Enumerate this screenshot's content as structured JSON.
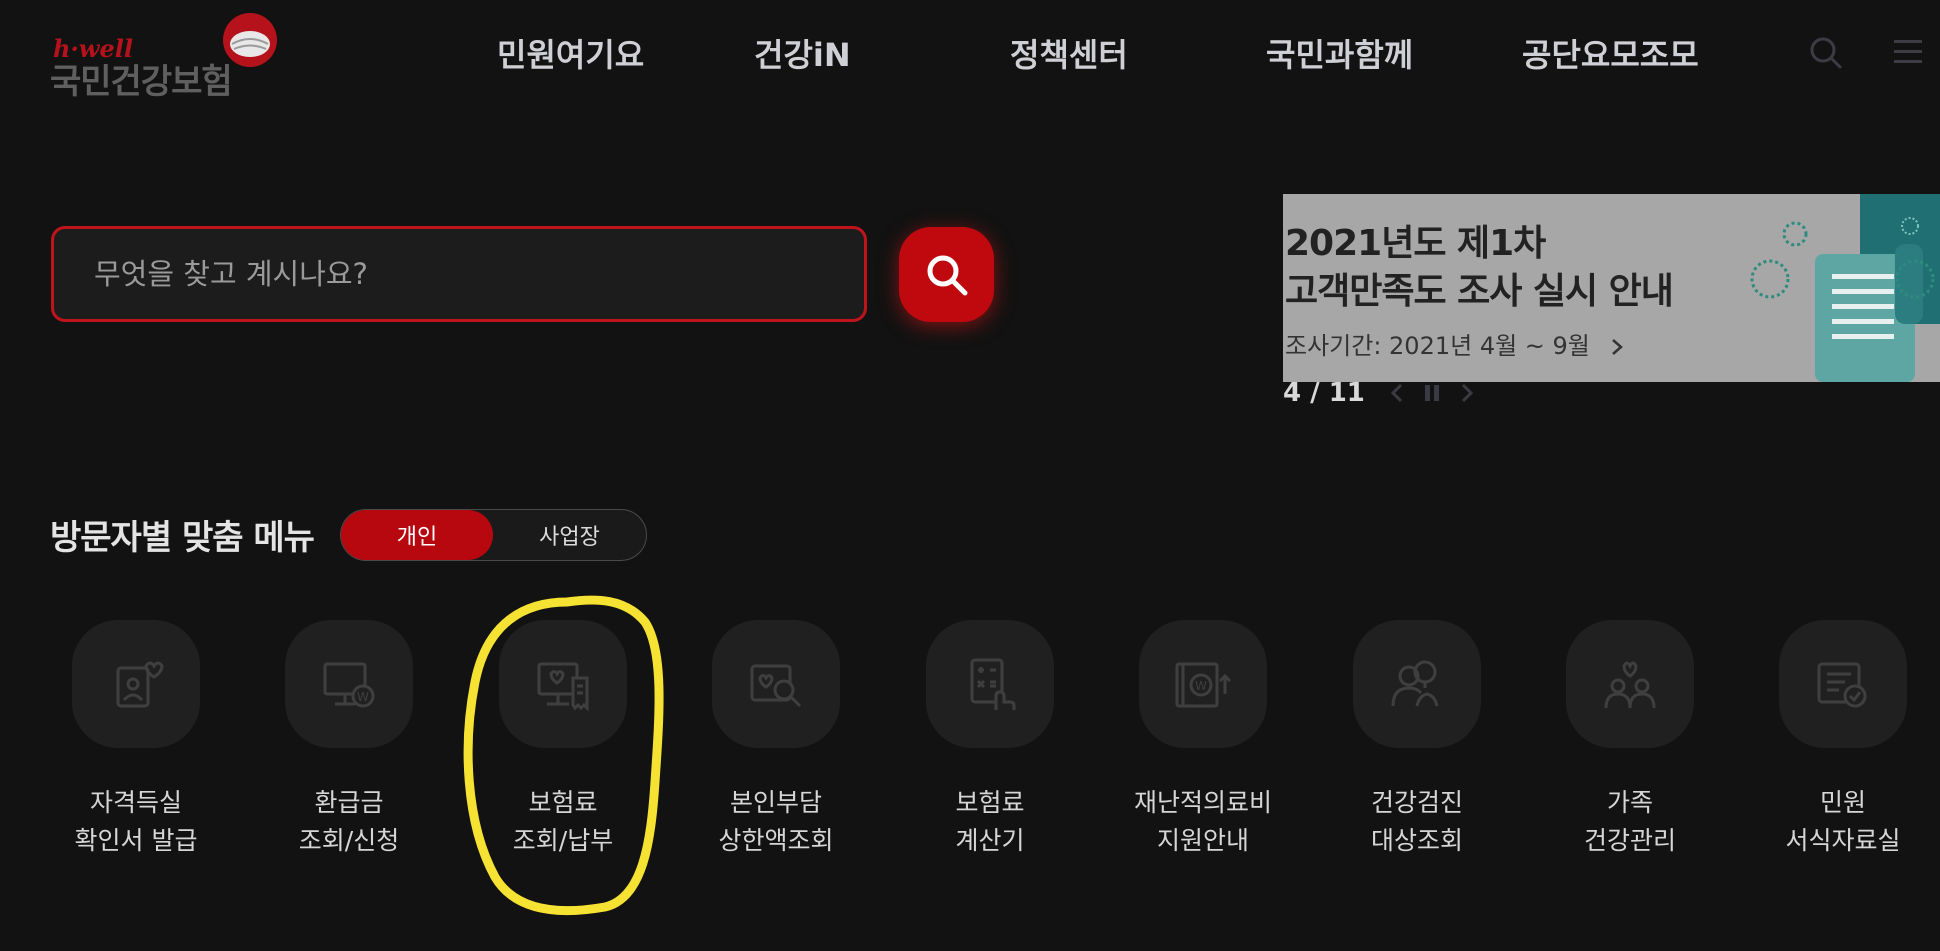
{
  "logo": {
    "small_text": "h·well",
    "main_text": "국민건강보험"
  },
  "gnb": {
    "items": [
      "민원여기요",
      "건강iN",
      "정책센터",
      "국민과함께",
      "공단요모조모"
    ],
    "search_icon": "search-icon",
    "menu_icon": "hamburger-menu-icon"
  },
  "search": {
    "placeholder": "무엇을 찾고 계시나요?",
    "value": ""
  },
  "banner": {
    "title_line1": "2021년도 제1차",
    "title_line2": "고객만족도 조사 실시 안내",
    "subtitle": "조사기간: 2021년 4월 ~ 9월",
    "pager": "4 / 11"
  },
  "visitor_menu": {
    "title": "방문자별 맞춤 메뉴",
    "toggle": {
      "options": [
        "개인",
        "사업장"
      ],
      "selected": "개인"
    },
    "items": [
      {
        "line1": "자격득실",
        "line2": "확인서 발급",
        "icon": "document-heart-icon"
      },
      {
        "line1": "환급금",
        "line2": "조회/신청",
        "icon": "monitor-won-icon"
      },
      {
        "line1": "보험료",
        "line2": "조회/납부",
        "icon": "monitor-receipt-icon"
      },
      {
        "line1": "본인부담",
        "line2": "상한액조회",
        "icon": "search-heart-icon"
      },
      {
        "line1": "보험료",
        "line2": "계산기",
        "icon": "calculator-icon"
      },
      {
        "line1": "재난적의료비",
        "line2": "지원안내",
        "icon": "book-won-icon"
      },
      {
        "line1": "건강검진",
        "line2": "대상조회",
        "icon": "person-search-icon"
      },
      {
        "line1": "가족",
        "line2": "건강관리",
        "icon": "family-heart-icon"
      },
      {
        "line1": "민원",
        "line2": "서식자료실",
        "icon": "document-check-icon"
      }
    ]
  },
  "colors": {
    "accent": "#c0090f",
    "background": "#121212",
    "highlight": "#f5e232"
  }
}
